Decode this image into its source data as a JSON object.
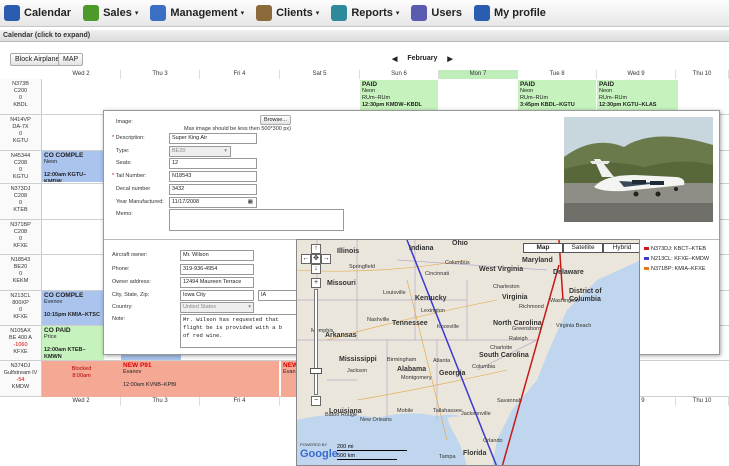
{
  "nav": [
    {
      "label": "Calendar",
      "icon": "calendar-icon",
      "color": "#2a5db0",
      "caret": false
    },
    {
      "label": "Sales",
      "icon": "sales-icon",
      "color": "#4c9a2a",
      "caret": true
    },
    {
      "label": "Management",
      "icon": "management-icon",
      "color": "#3a6fc4",
      "caret": true
    },
    {
      "label": "Clients",
      "icon": "clients-icon",
      "color": "#8a6a3a",
      "caret": true
    },
    {
      "label": "Reports",
      "icon": "reports-icon",
      "color": "#2c8a9a",
      "caret": true
    },
    {
      "label": "Users",
      "icon": "users-icon",
      "color": "#5a5ab0",
      "caret": false
    },
    {
      "label": "My profile",
      "icon": "profile-icon",
      "color": "#2a5db0",
      "caret": false
    }
  ],
  "calendar_bar": "Calendar (click to expand)",
  "toolbar": {
    "block_airplane": "Block Airplane",
    "map": "MAP"
  },
  "month": {
    "prev": "◀",
    "label": "February",
    "next": "▶"
  },
  "days": [
    "Wed 2",
    "Thu 3",
    "Fri 4",
    "Sat 5",
    "Sun 6",
    "Mon 7",
    "Tue 8",
    "Wed 9",
    "Thu 10"
  ],
  "aircraft": [
    {
      "tail": "N373B",
      "model": "C200",
      "num": "0",
      "base": "KBDL"
    },
    {
      "tail": "N414VP",
      "model": "DA-7X",
      "num": "0",
      "base": "KGTU"
    },
    {
      "tail": "N45344",
      "model": "C208",
      "num": "0",
      "base": "KGTU"
    },
    {
      "tail": "N373DJ",
      "model": "C208",
      "num": "0",
      "base": "KTEB"
    },
    {
      "tail": "N371BP",
      "model": "C208",
      "num": "0",
      "base": "KFXE"
    },
    {
      "tail": "N18543",
      "model": "BE20",
      "num": "0",
      "base": "KEKM"
    },
    {
      "tail": "N213CL",
      "model": "800XP",
      "num": "0",
      "base": "KFXE"
    },
    {
      "tail": "N105AX",
      "model": "BE 400 A",
      "num": "-1060",
      "base": "KFXE"
    },
    {
      "tail": "N374DJ",
      "model": "Gulfstream IV",
      "num": "-54",
      "base": "KMDW"
    }
  ],
  "events": {
    "sun6": {
      "title": "PAID",
      "client": "Neon",
      "route": "RUm–RUm",
      "time": "12:30pm KMDW–KBDL"
    },
    "tue8": {
      "title": "PAID",
      "client": "Neon",
      "route": "RUm–RUm",
      "time": "3:45pm KBDL–KGTU"
    },
    "wed9": {
      "title": "PAID",
      "client": "Neon",
      "route": "RUm–RUm",
      "time": "12:30pm KGTU–KLAS"
    },
    "complete1": {
      "title": "CO COMPLE",
      "client": "Neon",
      "time": "12:00am KGTU–KMDW"
    },
    "complete2": {
      "title": "CO COMPLE",
      "client": "Evenov",
      "time": "10:15pm KMIA–KTSC"
    },
    "paid": {
      "title": "CO PAID",
      "client": "Price",
      "time": "12:00am KTEB–KMWN"
    },
    "blocked": {
      "title": "Blocked",
      "time": "8:00am"
    },
    "newp91": {
      "title": "NEW P91",
      "client": "Evanov",
      "time": "12:00am KVNB–KPBI"
    },
    "new_partial": {
      "title": "NEW",
      "client": "Evan"
    }
  },
  "form": {
    "image_label": "Image:",
    "browse": "Browse...",
    "image_note": "Max image should be less then 500*300 px)",
    "description_label": "Description:",
    "description": "Super King Air",
    "type_label": "Type:",
    "type": "BE20",
    "seats_label": "Seats:",
    "seats": "12",
    "tail_label": "Tail Number:",
    "tail": "N18543",
    "decal_label": "Decal number",
    "decal": "3432",
    "year_label": "Year Manufactured:",
    "year": "11/17/2008",
    "memo_label": "Memo:",
    "owner_label": "Aircraft owner:",
    "owner": "Mr. Wilson",
    "phone_label": "Phone:",
    "phone": "319-936-4954",
    "address_label": "Owner address:",
    "address": "12494 Maureen Terrace",
    "city_label": "City, State, Zip:",
    "city": "Iowa City",
    "state": "IA",
    "country_label": "Country:",
    "country": "United States",
    "note_label": "Note:",
    "note_lines": [
      "Mr. Wilson has requested that",
      "flight be is provided with a b",
      "of red wine."
    ]
  },
  "map": {
    "types": [
      "Map",
      "Satellite",
      "Hybrid"
    ],
    "states": [
      {
        "name": "Illinois"
      },
      {
        "name": "Indiana"
      },
      {
        "name": "Ohio"
      },
      {
        "name": "Maryland"
      },
      {
        "name": "Delaware"
      },
      {
        "name": "Missouri"
      },
      {
        "name": "West Virginia"
      },
      {
        "name": "District of Columbia"
      },
      {
        "name": "Kentucky"
      },
      {
        "name": "Virginia"
      },
      {
        "name": "Arkansas"
      },
      {
        "name": "Tennessee"
      },
      {
        "name": "North Carolina"
      },
      {
        "name": "Mississippi"
      },
      {
        "name": "South Carolina"
      },
      {
        "name": "Alabama"
      },
      {
        "name": "Georgia"
      },
      {
        "name": "Louisiana"
      },
      {
        "name": "Florida"
      }
    ],
    "cities": [
      "Springfield",
      "Columbus",
      "Cincinnati",
      "Charleston",
      "Richmond",
      "Louisville",
      "Lexington",
      "Nashville",
      "Knoxville",
      "Memphis",
      "Raleigh",
      "Greensboro",
      "Charlotte",
      "Atlanta",
      "Birmingham",
      "Columbia",
      "Jackson",
      "Montgomery",
      "Savannah",
      "Jacksonville",
      "New Orleans",
      "Baton Rouge",
      "Mobile",
      "Tallahassee",
      "Orlando",
      "Tampa",
      "Virginia Beach",
      "Washington"
    ],
    "scale_mi": "200 mi",
    "scale_km": "500 km",
    "brand": "Google",
    "powered": "POWERED BY"
  },
  "legend": [
    {
      "label": "N373DJ: KBCT–KTEB",
      "color": "#d01818"
    },
    {
      "label": "N213CL: KFXE–KMDW",
      "color": "#3a3ad0"
    },
    {
      "label": "N371BP: KMIA–KFXE",
      "color": "#e07a1a"
    }
  ]
}
